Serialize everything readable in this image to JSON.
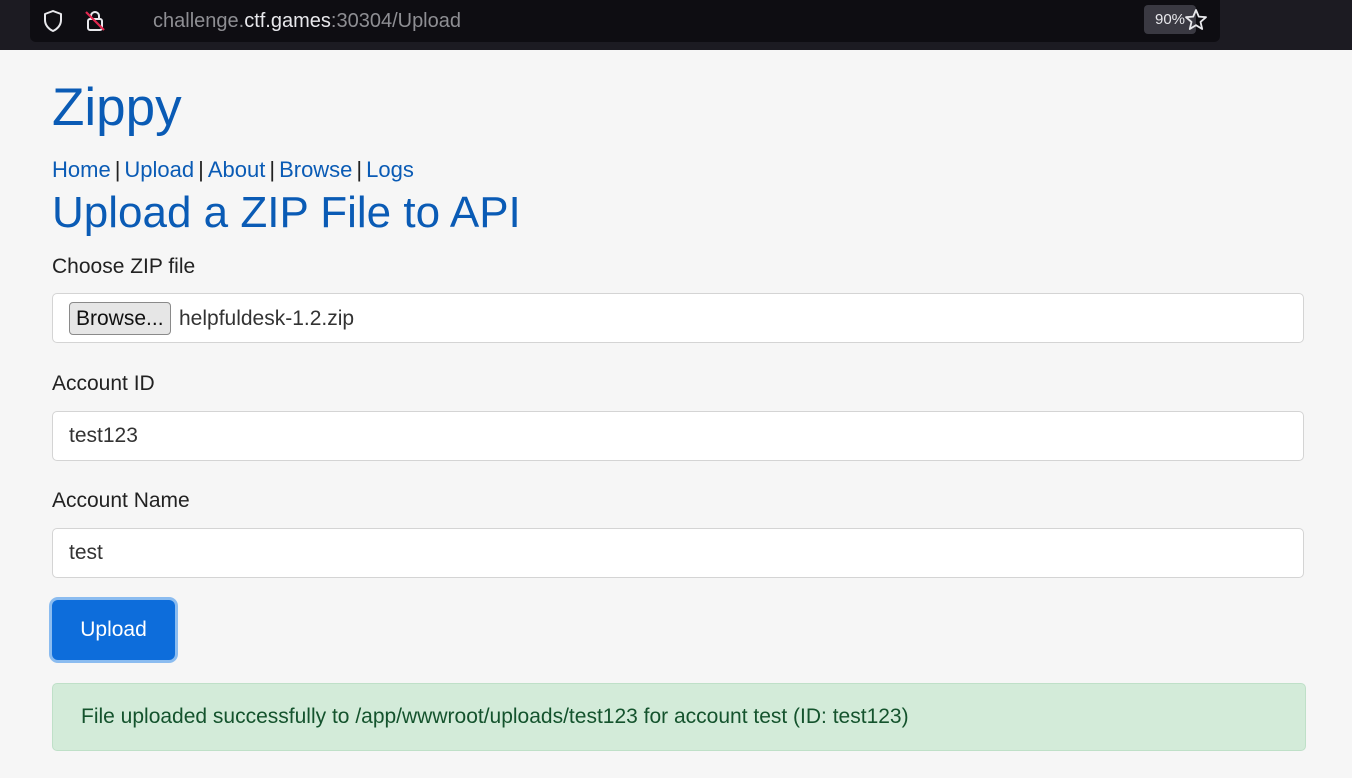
{
  "browser": {
    "url_prefix": "challenge.",
    "url_host": "ctf.games",
    "url_suffix": ":30304/Upload",
    "zoom": "90%",
    "icons": [
      "shield-icon",
      "insecure-lock-icon",
      "star-icon"
    ]
  },
  "site": {
    "brand": "Zippy",
    "nav": [
      {
        "label": "Home"
      },
      {
        "label": "Upload"
      },
      {
        "label": "About"
      },
      {
        "label": "Browse"
      },
      {
        "label": "Logs"
      }
    ],
    "nav_separator": "|"
  },
  "form": {
    "title": "Upload a ZIP File to API",
    "zip_label": "Choose ZIP file",
    "browse_label": "Browse...",
    "zip_filename": "helpfuldesk-1.2.zip",
    "account_id_label": "Account ID",
    "account_id_value": "test123",
    "account_name_label": "Account Name",
    "account_name_value": "test",
    "submit_label": "Upload"
  },
  "alert": {
    "message": "File uploaded successfully to /app/wwwroot/uploads/test123 for account test (ID: test123)"
  },
  "colors": {
    "link": "#0a5bb5",
    "primary_button": "#0d6ddb",
    "success_bg": "#d3ebd9",
    "success_text": "#14532d"
  }
}
